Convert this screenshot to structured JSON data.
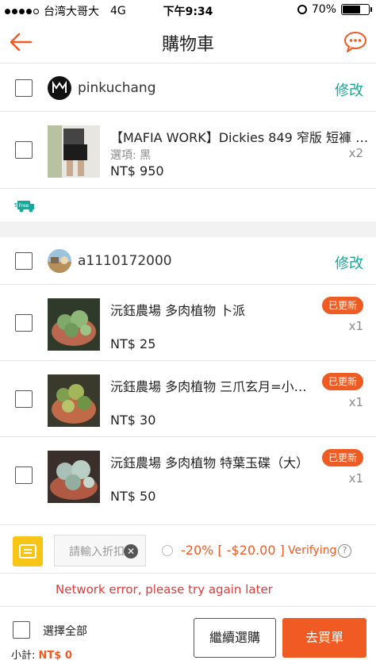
{
  "status_bar": {
    "carrier": "台湾大哥大",
    "network": "4G",
    "time": "下午9:34",
    "battery": "70%",
    "battery_level": 0.7
  },
  "nav": {
    "title": "購物車",
    "back_icon": "back-arrow-icon",
    "chat_icon": "chat-bubble-icon"
  },
  "shops": [
    {
      "name": "pinkuchang",
      "edit_label": "修改",
      "items": [
        {
          "name": "【MAFIA WORK】Dickies 849 窄版 短褲 …",
          "variant": "選項: 黑",
          "price": "NT$ 950",
          "qty": "x2"
        }
      ],
      "shipping_badge": "Free"
    },
    {
      "name": "a1110172000",
      "edit_label": "修改",
      "items": [
        {
          "name": "沅鈺農場 多肉植物 卜派",
          "price": "NT$ 25",
          "qty": "x1",
          "badge": "已更新"
        },
        {
          "name": "沅鈺農場 多肉植物 三爪玄月=小…",
          "price": "NT$ 30",
          "qty": "x1",
          "badge": "已更新"
        },
        {
          "name": "沅鈺農場 多肉植物 特葉玉碟（大）",
          "price": "NT$ 50",
          "qty": "x1",
          "badge": "已更新"
        }
      ]
    }
  ],
  "voucher": {
    "input_placeholder": "請輸入折扣",
    "discount_text": "-20% [ -$20.00 ]",
    "status": "Verifying",
    "error": "Network error, please try again later"
  },
  "footer": {
    "select_all": "選擇全部",
    "subtotal_label": "小計:",
    "subtotal_value": "NT$ 0",
    "continue_label": "繼續選購",
    "checkout_label": "去買單"
  },
  "colors": {
    "accent": "#f05a23",
    "edit": "#16a89a",
    "error": "#e03a3a",
    "voucher": "#f7c516"
  }
}
